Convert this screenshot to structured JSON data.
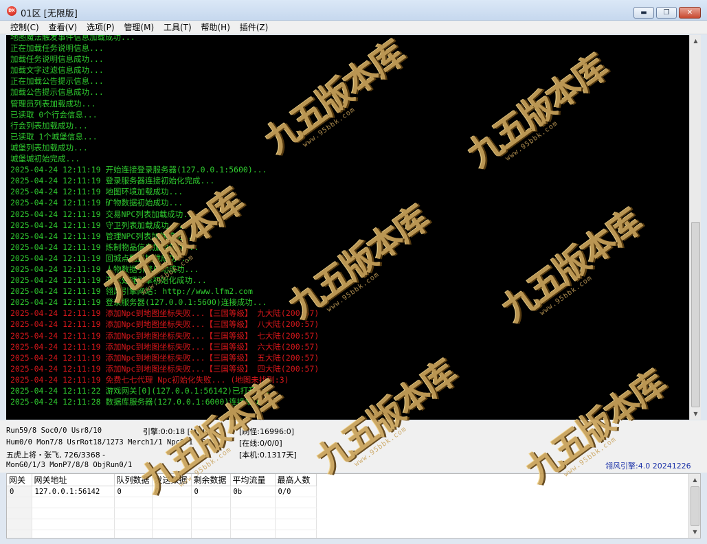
{
  "window": {
    "title": "01区 [无限版]",
    "icon": "app-logo-icon",
    "icon_text": "DX",
    "minimize": "▬",
    "maximize": "❐",
    "close": "✕"
  },
  "menu": [
    "控制(C)",
    "查看(V)",
    "选项(P)",
    "管理(M)",
    "工具(T)",
    "帮助(H)",
    "插件(Z)"
  ],
  "log": [
    {
      "text": "地图魔法触发事件信息加载成功...",
      "level": "ok"
    },
    {
      "text": "正在加载任务说明信息...",
      "level": "ok"
    },
    {
      "text": "加载任务说明信息成功...",
      "level": "ok"
    },
    {
      "text": "加载文字过滤信息成功...",
      "level": "ok"
    },
    {
      "text": "正在加载公告提示信息...",
      "level": "ok"
    },
    {
      "text": "加载公告提示信息成功...",
      "level": "ok"
    },
    {
      "text": "管理员列表加载成功...",
      "level": "ok"
    },
    {
      "text": "已读取 0个行会信息...",
      "level": "ok"
    },
    {
      "text": "行会列表加载成功...",
      "level": "ok"
    },
    {
      "text": "已读取 1个城堡信息...",
      "level": "ok"
    },
    {
      "text": "城堡列表加载成功...",
      "level": "ok"
    },
    {
      "text": "城堡城初始完成...",
      "level": "ok"
    },
    {
      "text": "2025-04-24 12:11:19 开始连接登录服务器(127.0.0.1:5600)...",
      "level": "ok"
    },
    {
      "text": "2025-04-24 12:11:19 登录服务器连接初始化完成...",
      "level": "ok"
    },
    {
      "text": "2025-04-24 12:11:19 地图环境加载成功...",
      "level": "ok"
    },
    {
      "text": "2025-04-24 12:11:19 矿物数据初始成功...",
      "level": "ok"
    },
    {
      "text": "2025-04-24 12:11:19 交易NPC列表加载成功...",
      "level": "ok"
    },
    {
      "text": "2025-04-24 12:11:19 守卫列表加载成功...",
      "level": "ok"
    },
    {
      "text": "2025-04-24 12:11:19 管理NPC列表加载成功...",
      "level": "ok"
    },
    {
      "text": "2025-04-24 12:11:19 炼制物品信息加载成功...",
      "level": "ok"
    },
    {
      "text": "2025-04-24 12:11:19 回城点配置加载成功...",
      "level": "ok"
    },
    {
      "text": "2025-04-24 12:11:19 人物数据引擎启动成功...",
      "level": "ok"
    },
    {
      "text": "2025-04-24 12:11:19 游戏处理引擎初始化成功...",
      "level": "ok"
    },
    {
      "text": "2025-04-24 12:11:19 翎风引擎网站: http://www.lfm2.com",
      "level": "ok"
    },
    {
      "text": "2025-04-24 12:11:19 登录服务器(127.0.0.1:5600)连接成功...",
      "level": "ok"
    },
    {
      "text": "2025-04-24 12:11:19 添加Npc到地图坐标失败...【三国等级】 九大陆(200:57)",
      "level": "err"
    },
    {
      "text": "2025-04-24 12:11:19 添加Npc到地图坐标失败...【三国等级】 八大陆(200:57)",
      "level": "err"
    },
    {
      "text": "2025-04-24 12:11:19 添加Npc到地图坐标失败...【三国等级】 七大陆(200:57)",
      "level": "err"
    },
    {
      "text": "2025-04-24 12:11:19 添加Npc到地图坐标失败...【三国等级】 六大陆(200:57)",
      "level": "err"
    },
    {
      "text": "2025-04-24 12:11:19 添加Npc到地图坐标失败...【三国等级】 五大陆(200:57)",
      "level": "err"
    },
    {
      "text": "2025-04-24 12:11:19 添加Npc到地图坐标失败...【三国等级】 四大陆(200:57)",
      "level": "err"
    },
    {
      "text": "2025-04-24 12:11:19 免费七七代理 Npc初始化失败... (地图未找到:3)",
      "level": "err"
    },
    {
      "text": "2025-04-24 12:11:22 游戏网关[0](127.0.0.1:56142)已打开...",
      "level": "ok"
    },
    {
      "text": "2025-04-24 12:11:28 数据库服务器(127.0.0.1:6000)连接成功...",
      "level": "ok"
    }
  ],
  "status": {
    "line1_left": "Run59/8 Soc0/0 Usr8/10",
    "engine_state": "引擎:0:0:18 [M][P]",
    "refresh_monsters": "[刷怪:16996:0]",
    "line2_left": "Hum0/0 Mon7/8 UsrRot18/1273 Merch1/1 Npc0/1 (0)",
    "online": "[在线:0/0/0]",
    "line3_left": "五虎上将・张飞, 726/3368 -",
    "local_uptime": "[本机:0.1317天]",
    "line4_left": "MonG0/1/3 MonP7/8/8 ObjRun0/1",
    "engine_version": "翎风引擎:4.0 20241226"
  },
  "gateway_table": {
    "columns": [
      "网关",
      "网关地址",
      "队列数据",
      "发送数据",
      "剩余数据",
      "平均流量",
      "最高人数"
    ],
    "rows": [
      [
        "0",
        "127.0.0.1:56142",
        "0",
        "0",
        "0",
        "0b",
        "0/0"
      ],
      [
        "",
        "",
        "",
        "",
        "",
        "",
        ""
      ],
      [
        "",
        "",
        "",
        "",
        "",
        "",
        ""
      ],
      [
        "",
        "",
        "",
        "",
        "",
        "",
        ""
      ],
      [
        "",
        "",
        "",
        "",
        "",
        "",
        ""
      ]
    ]
  },
  "watermark": {
    "main": "九五版本库",
    "sub": "www.95bbk.com",
    "color": "#c9a25a"
  },
  "colors": {
    "log_ok": "#2fcb2f",
    "log_err": "#d8171b",
    "console_bg": "#000000",
    "engine_version": "#1a31a8"
  }
}
